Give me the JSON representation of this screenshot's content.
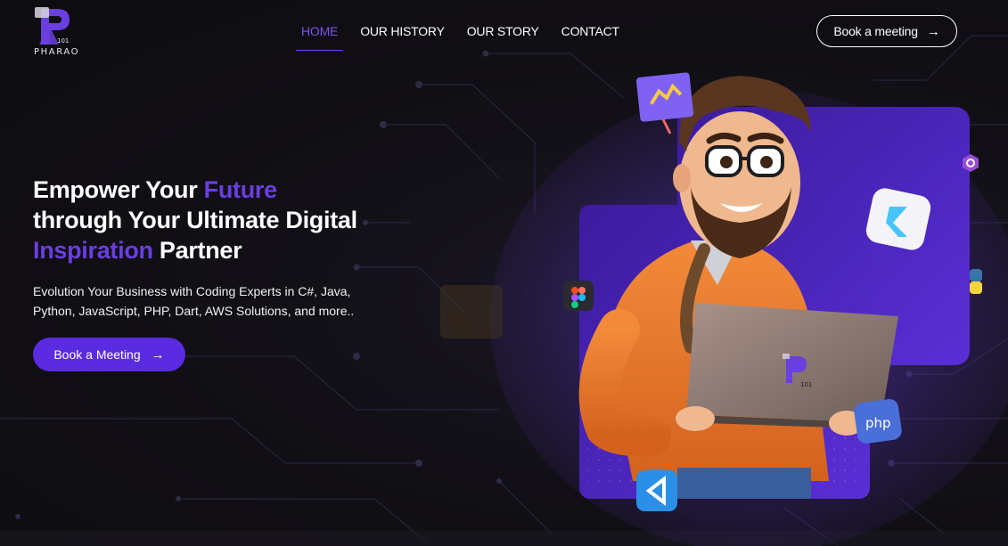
{
  "brand": {
    "logo_name": "PHARAO",
    "logo_badge": "101"
  },
  "nav": {
    "items": [
      {
        "label": "HOME",
        "active": true
      },
      {
        "label": "OUR HISTORY",
        "active": false
      },
      {
        "label": "OUR STORY",
        "active": false
      },
      {
        "label": "CONTACT",
        "active": false
      }
    ]
  },
  "header": {
    "cta_label": "Book a meeting",
    "cta_icon": "arrow-right-icon"
  },
  "hero": {
    "title_part1": "Empower Your ",
    "title_accent1": "Future",
    "title_part2": "through Your Ultimate Digital",
    "title_accent2": "Inspiration",
    "title_part3": " Partner",
    "subtitle": "Evolution Your Business with Coding Experts in C#, Java, Python, JavaScript, PHP, Dart, AWS Solutions, and more..",
    "cta_label": "Book a Meeting",
    "cta_icon": "arrow-right-icon"
  },
  "illustration": {
    "laptop_badge": "101",
    "php_label": "php",
    "icons": [
      "chart-sign-icon",
      "figma-icon",
      "flutter-icon",
      "csharp-icon",
      "python-icon",
      "php-icon",
      "vscode-icon"
    ]
  },
  "colors": {
    "accent": "#6a3fe0",
    "button": "#5a2be0",
    "background": "#0f0e12",
    "nav_active": "#7c52f0"
  }
}
